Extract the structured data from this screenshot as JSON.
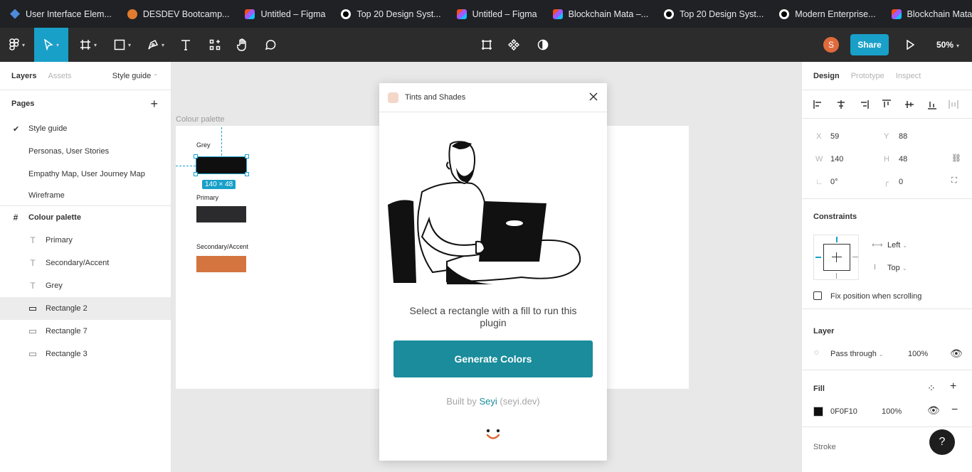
{
  "bookmarks": [
    {
      "label": "User Interface Elem...",
      "icon": "ui-icon"
    },
    {
      "label": "DESDEV Bootcamp...",
      "icon": "bootcamp-icon"
    },
    {
      "label": "Untitled – Figma",
      "icon": "figma-icon"
    },
    {
      "label": "Top 20 Design Syst...",
      "icon": "medium-icon"
    },
    {
      "label": "Untitled – Figma",
      "icon": "figma-icon"
    },
    {
      "label": "Blockchain Mata –...",
      "icon": "figma-icon"
    },
    {
      "label": "Top 20 Design Syst...",
      "icon": "medium-icon"
    },
    {
      "label": "Modern Enterprise...",
      "icon": "medium-icon"
    },
    {
      "label": "Blockchain Mata –...",
      "icon": "figma-icon"
    }
  ],
  "toolbar": {
    "avatar_initial": "S",
    "share_label": "Share",
    "zoom": "50%",
    "accent": "#18a0c9"
  },
  "left_panel": {
    "tabs": [
      "Layers",
      "Assets"
    ],
    "page_selector": "Style guide",
    "pages_title": "Pages",
    "pages": [
      "Style guide",
      "Personas, User Stories",
      "Empathy Map, User Journey Map",
      "Wireframe"
    ],
    "frame_name": "Colour palette",
    "layers": [
      {
        "label": "Primary",
        "type": "text"
      },
      {
        "label": "Secondary/Accent",
        "type": "text"
      },
      {
        "label": "Grey",
        "type": "text"
      },
      {
        "label": "Rectangle 2",
        "type": "rect"
      },
      {
        "label": "Rectangle 7",
        "type": "rect"
      },
      {
        "label": "Rectangle 3",
        "type": "rect"
      }
    ]
  },
  "canvas": {
    "frame_label": "Colour palette",
    "grey_label": "Grey",
    "primary_label": "Primary",
    "secondary_label": "Secondary/Accent",
    "dimension_badge": "140 × 48",
    "grey_color": "#0f0f10",
    "primary_color": "#2b2b2d",
    "secondary_color": "#d4743f"
  },
  "plugin": {
    "title": "Tints and Shades",
    "message": "Select a rectangle with a fill to run this plugin",
    "button_label": "Generate Colors",
    "built_by_prefix": "Built by",
    "author": "Seyi",
    "author_site": "(seyi.dev)",
    "button_color": "#1a8c9c"
  },
  "right_panel": {
    "tabs": [
      "Design",
      "Prototype",
      "Inspect"
    ],
    "x_label": "X",
    "x_value": "59",
    "y_label": "Y",
    "y_value": "88",
    "w_label": "W",
    "w_value": "140",
    "h_label": "H",
    "h_value": "48",
    "rotation_value": "0°",
    "radius_value": "0",
    "constraints_title": "Constraints",
    "constraint_h": "Left",
    "constraint_v": "Top",
    "fix_position_label": "Fix position when scrolling",
    "layer_title": "Layer",
    "blend_mode": "Pass through",
    "layer_opacity": "100%",
    "fill_title": "Fill",
    "fill_hex": "0F0F10",
    "fill_opacity": "100%",
    "stroke_title": "Stroke",
    "help_label": "?"
  }
}
